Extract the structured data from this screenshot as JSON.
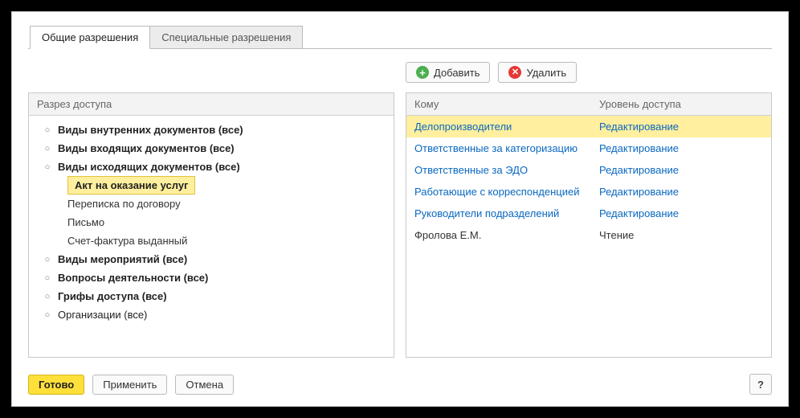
{
  "tabs": {
    "general": "Общие разрешения",
    "special": "Специальные разрешения"
  },
  "toolbar": {
    "add": "Добавить",
    "delete": "Удалить"
  },
  "tree": {
    "header": "Разрез доступа",
    "items": [
      {
        "label": "Виды внутренних документов (все)",
        "bold": true
      },
      {
        "label": "Виды входящих документов (все)",
        "bold": true
      },
      {
        "label": "Виды исходящих документов (все)",
        "bold": true,
        "children": [
          {
            "label": "Акт на оказание услуг",
            "selected": true
          },
          {
            "label": "Переписка по договору"
          },
          {
            "label": "Письмо"
          },
          {
            "label": "Счет-фактура выданный"
          }
        ]
      },
      {
        "label": "Виды мероприятий (все)",
        "bold": true
      },
      {
        "label": "Вопросы деятельности (все)",
        "bold": true
      },
      {
        "label": "Грифы доступа (все)",
        "bold": true
      },
      {
        "label": "Организации (все)",
        "bold": false
      }
    ]
  },
  "grid": {
    "col1": "Кому",
    "col2": "Уровень доступа",
    "rows": [
      {
        "who": "Делопроизводители",
        "level": "Редактирование",
        "selected": true,
        "link": true
      },
      {
        "who": "Ответственные за категоризацию",
        "level": "Редактирование",
        "link": true
      },
      {
        "who": "Ответственные за ЭДО",
        "level": "Редактирование",
        "link": true
      },
      {
        "who": "Работающие с корреспонденцией",
        "level": "Редактирование",
        "link": true
      },
      {
        "who": "Руководители подразделений",
        "level": "Редактирование",
        "link": true
      },
      {
        "who": "Фролова Е.М.",
        "level": "Чтение",
        "link": false
      }
    ]
  },
  "footer": {
    "ok": "Готово",
    "apply": "Применить",
    "cancel": "Отмена",
    "help": "?"
  }
}
